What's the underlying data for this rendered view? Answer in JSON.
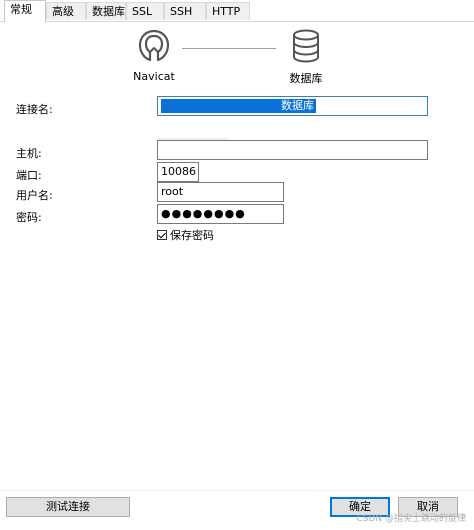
{
  "tabs": [
    {
      "label": "常规",
      "active": true
    },
    {
      "label": "高级",
      "active": false
    },
    {
      "label": "数据库",
      "active": false
    },
    {
      "label": "SSL",
      "active": false
    },
    {
      "label": "SSH",
      "active": false
    },
    {
      "label": "HTTP",
      "active": false
    }
  ],
  "header": {
    "left_label": "Navicat",
    "right_label": "数据库",
    "left_icon": "navicat-logo-icon",
    "right_icon": "database-icon"
  },
  "form": {
    "connection_name_label": "连接名:",
    "connection_name_value": "数据库",
    "host_label": "主机:",
    "host_value": "",
    "port_label": "端口:",
    "port_value": "10086",
    "username_label": "用户名:",
    "username_value": "root",
    "password_label": "密码:",
    "password_value": "●●●●●●●●",
    "save_password_label": "保存密码",
    "save_password_checked": true
  },
  "buttons": {
    "test_label": "测试连接",
    "ok_label": "确定",
    "cancel_label": "取消"
  },
  "watermark": "CSDN @指尖上跳动的旋律",
  "colors": {
    "selection": "#0a72d6",
    "focus_border": "#0078d7"
  }
}
